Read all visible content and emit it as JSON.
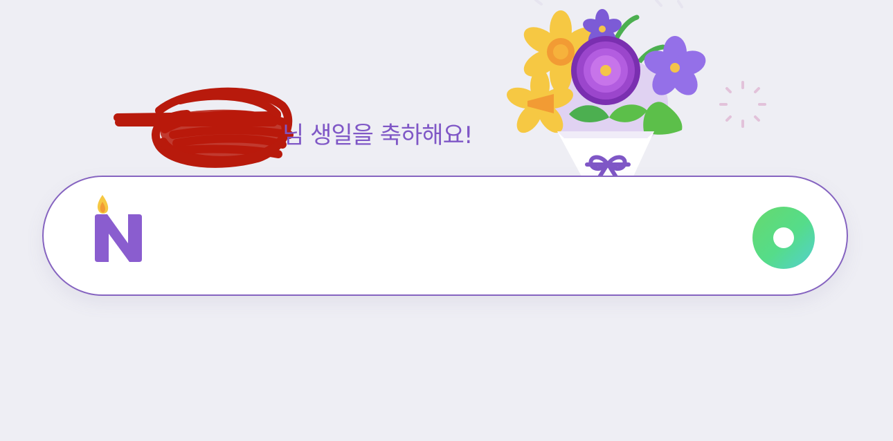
{
  "greeting": {
    "text": "님 생일을 축하해요!",
    "color": "#7f57c6"
  },
  "search": {
    "placeholder": "",
    "value": "",
    "border_color": "#8563c0",
    "logo_icon": "birthday-candle-n-logo-icon",
    "button_icon": "search-ring-icon"
  }
}
